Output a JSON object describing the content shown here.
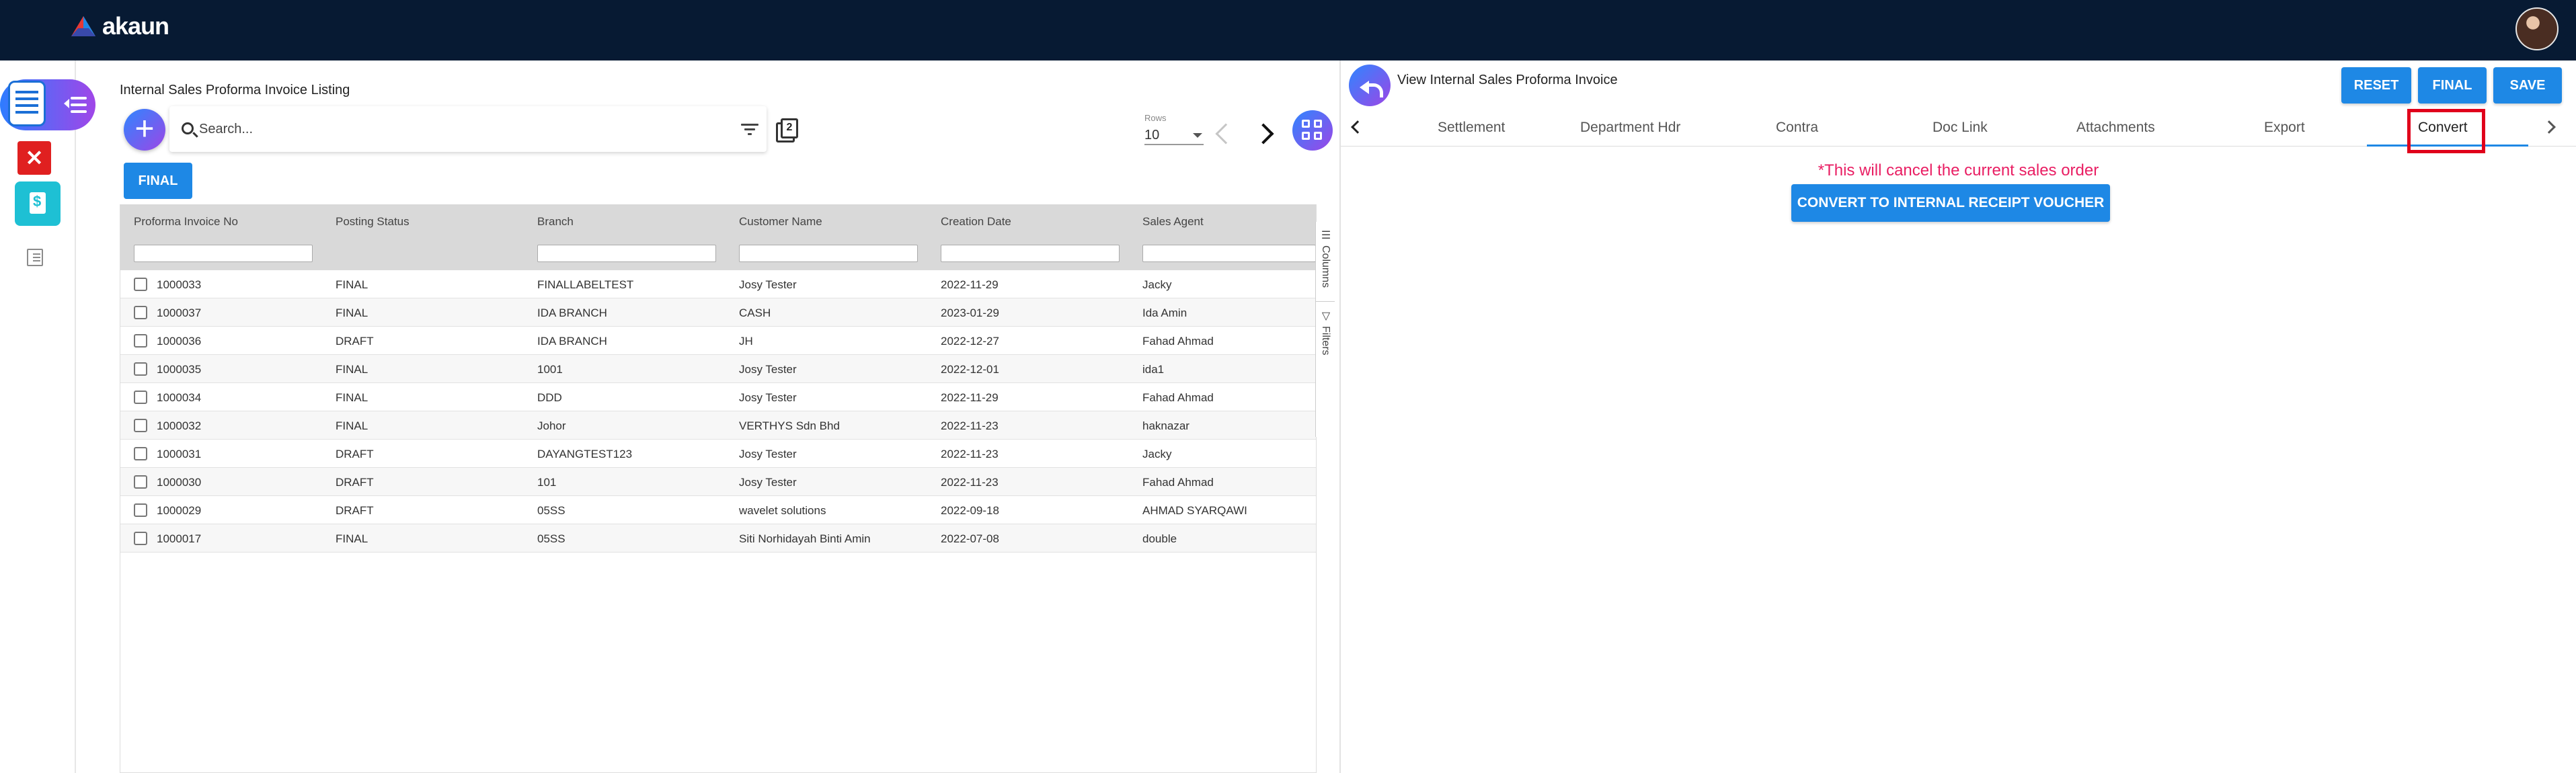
{
  "app": {
    "brand": "akaun"
  },
  "listing": {
    "title": "Internal Sales Proforma Invoice Listing",
    "search_placeholder": "Search...",
    "rows_label": "Rows",
    "rows_value": "10",
    "final_filter_label": "FINAL",
    "columns": [
      "Proforma Invoice No",
      "Posting Status",
      "Branch",
      "Customer Name",
      "Creation Date",
      "Sales Agent"
    ],
    "rows": [
      [
        "1000033",
        "FINAL",
        "FINALLABELTEST",
        "Josy Tester",
        "2022-11-29",
        "Jacky"
      ],
      [
        "1000037",
        "FINAL",
        "IDA BRANCH",
        "CASH",
        "2023-01-29",
        "Ida Amin"
      ],
      [
        "1000036",
        "DRAFT",
        "IDA BRANCH",
        "JH",
        "2022-12-27",
        "Fahad Ahmad"
      ],
      [
        "1000035",
        "FINAL",
        "1001",
        "Josy Tester",
        "2022-12-01",
        "ida1"
      ],
      [
        "1000034",
        "FINAL",
        "DDD",
        "Josy Tester",
        "2022-11-29",
        "Fahad Ahmad"
      ],
      [
        "1000032",
        "FINAL",
        "Johor",
        "VERTHYS Sdn Bhd",
        "2022-11-23",
        "haknazar"
      ],
      [
        "1000031",
        "DRAFT",
        "DAYANGTEST123",
        "Josy Tester",
        "2022-11-23",
        "Jacky"
      ],
      [
        "1000030",
        "DRAFT",
        "101",
        "Josy Tester",
        "2022-11-23",
        "Fahad Ahmad"
      ],
      [
        "1000029",
        "DRAFT",
        "05SS",
        "wavelet solutions",
        "2022-09-18",
        "AHMAD SYARQAWI"
      ],
      [
        "1000017",
        "FINAL",
        "05SS",
        "Siti Norhidayah Binti Amin",
        "2022-07-08",
        "double"
      ]
    ],
    "side_tabs": {
      "columns": "Columns",
      "filters": "Filters"
    }
  },
  "detail": {
    "title": "View Internal Sales Proforma Invoice",
    "buttons": {
      "reset": "RESET",
      "final": "FINAL",
      "save": "SAVE"
    },
    "tabs": [
      "Settlement",
      "Department Hdr",
      "Contra",
      "Doc Link",
      "Attachments",
      "Export",
      "Convert"
    ],
    "active_tab": "Convert",
    "warning": "*This will cancel the current sales order",
    "convert_button": "CONVERT TO INTERNAL RECEIPT VOUCHER"
  },
  "colors": {
    "topbar": "#071a33",
    "primary": "#1e88e5",
    "warning": "#e91e63",
    "highlight": "#e0001b"
  },
  "icons": [
    "akaun-logo-icon",
    "avatar",
    "sales-doc-icon",
    "menu-collapse-icon",
    "pdf-icon",
    "receipt-icon",
    "list-icon",
    "add-icon",
    "search-icon",
    "filter-icon",
    "copy-icon",
    "chevron-left-icon",
    "chevron-right-icon",
    "grid-view-icon",
    "back-icon"
  ]
}
